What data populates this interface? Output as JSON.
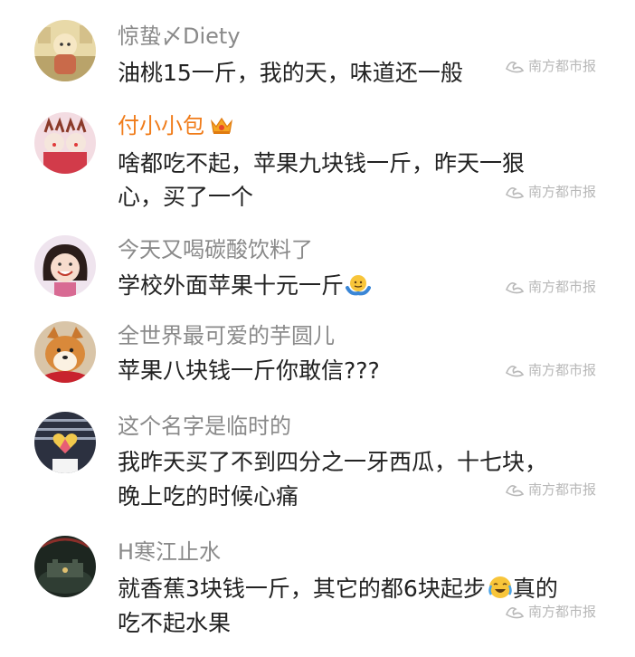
{
  "colors": {
    "username": "#8a8a8a",
    "vip_username": "#f07c1a",
    "content": "#222222",
    "watermark": "#b8b8b8"
  },
  "watermark": "南方都市报",
  "comments": [
    {
      "username": "惊蛰〆Diety",
      "text": "油桃15一斤，我的天，味道还一般",
      "avatar_icon": "cartoon-avatar-icon"
    },
    {
      "username": "付小小包",
      "username_badge_icon": "vip-crown-icon",
      "text_line1": "啥都吃不起，苹果九块钱一斤，昨天一狠",
      "text_line2": "心，买了一个",
      "avatar_icon": "reindeer-girls-avatar-icon"
    },
    {
      "username": "今天又喝碳酸饮料了",
      "text": "学校外面苹果十元一斤",
      "text_emoji_icon": "shrug-emoji-icon",
      "avatar_icon": "smiling-girl-avatar-icon"
    },
    {
      "username": "全世界最可爱的芋圆儿",
      "text": "苹果八块钱一斤你敢信???",
      "avatar_icon": "shiba-dog-avatar-icon"
    },
    {
      "username": "这个名字是临时的",
      "text_line1": "我昨天买了不到四分之一牙西瓜，十七块，",
      "text_line2": "晚上吃的时候心痛",
      "avatar_icon": "heart-stage-avatar-icon"
    },
    {
      "username": "H寒江止水",
      "text_line1": "就香蕉3块钱一斤，其它的都6块起步",
      "text_line1_emoji_icon": "crying-laugh-emoji-icon",
      "text_line1_after": "真的",
      "text_line2": "吃不起水果",
      "avatar_icon": "dark-castle-avatar-icon"
    }
  ]
}
